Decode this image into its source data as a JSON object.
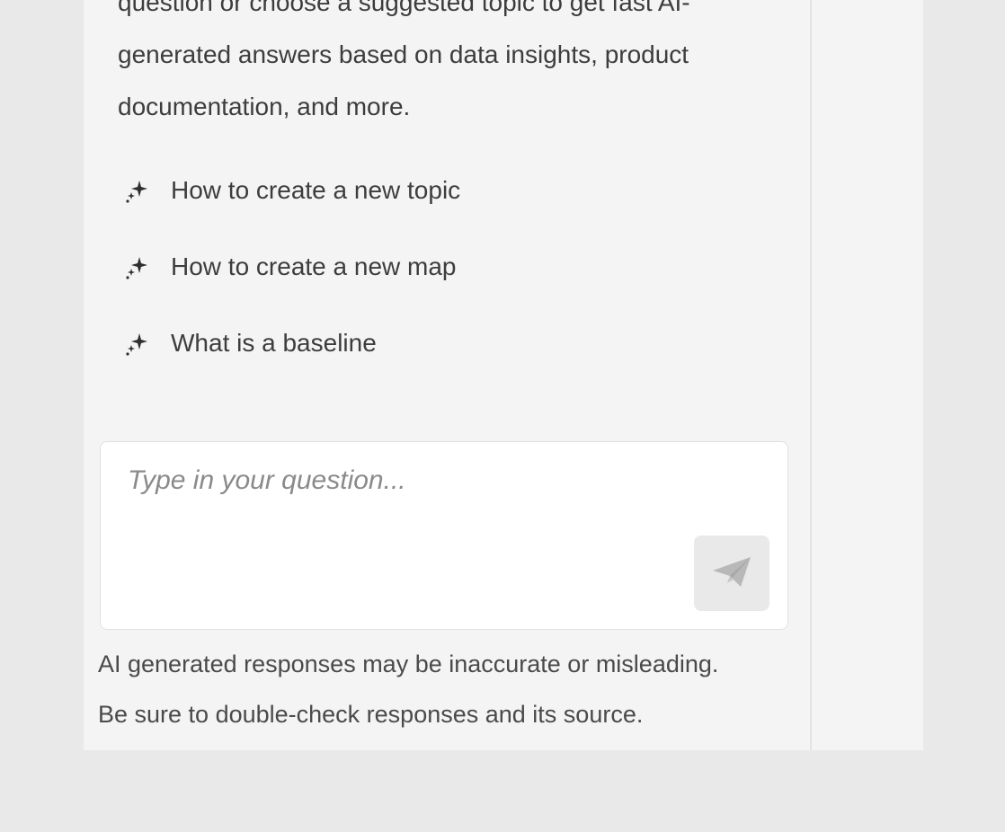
{
  "intro": {
    "line1": "question or choose a suggested topic to get fast AI-",
    "line2": "generated answers based on data insights, product",
    "line3": "documentation, and more."
  },
  "suggestions": [
    {
      "label": "How to create a new topic",
      "icon": "sparkle-icon"
    },
    {
      "label": "How to create a new map",
      "icon": "sparkle-icon"
    },
    {
      "label": "What is a baseline",
      "icon": "sparkle-icon"
    }
  ],
  "input": {
    "placeholder": "Type in your question...",
    "value": "",
    "send_icon": "paper-plane-icon"
  },
  "disclaimer": {
    "line1": "AI generated responses may be inaccurate or misleading.",
    "line2": "Be sure to double-check responses and its source."
  },
  "colors": {
    "background": "#e9e9e9",
    "panel": "#f4f4f4",
    "text": "#3d3d3d",
    "placeholder": "#8a8a8a",
    "send_button_bg": "#e9e9e9",
    "send_icon": "#b5b5b5"
  }
}
